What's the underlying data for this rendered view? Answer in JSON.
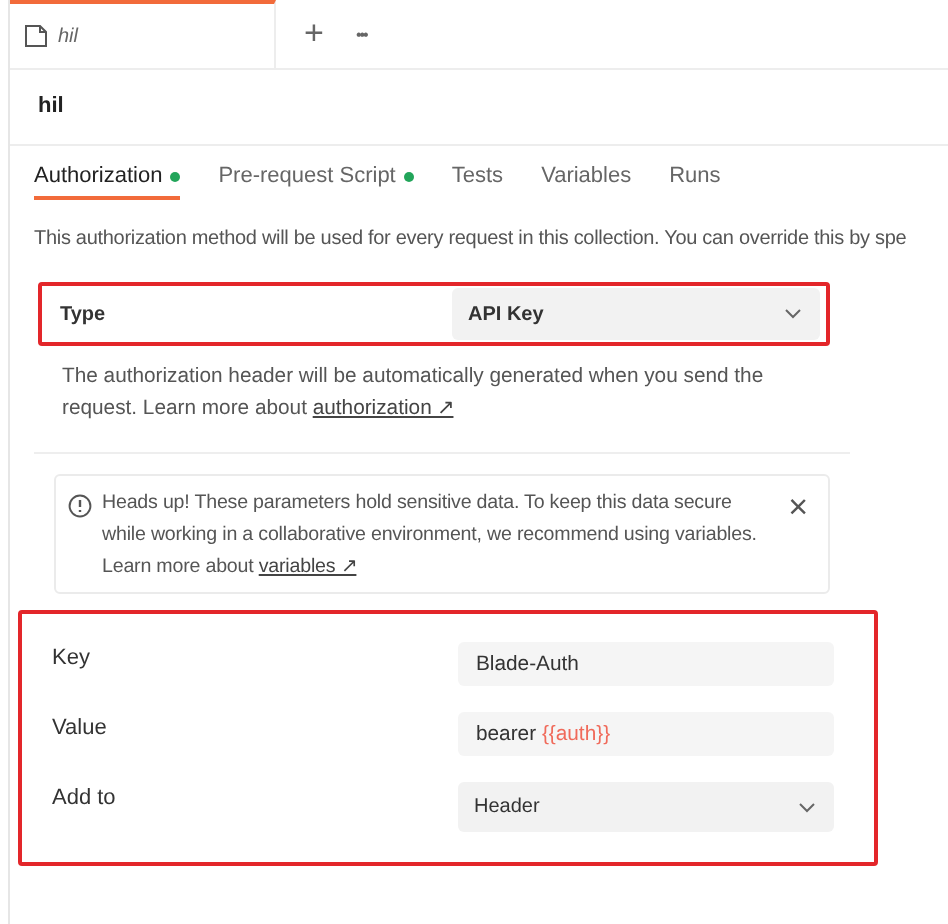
{
  "open_tab": {
    "title": "hil",
    "selected": true
  },
  "tab_actions": [
    "+",
    "•••"
  ],
  "collection_name": "hil",
  "tabs": [
    {
      "label": "Authorization",
      "selected": true,
      "has_dot": true
    },
    {
      "label": "Pre-request Script",
      "selected": false,
      "has_dot": true
    },
    {
      "label": "Tests",
      "selected": false,
      "has_dot": false
    },
    {
      "label": "Variables",
      "selected": false,
      "has_dot": false
    },
    {
      "label": "Runs",
      "selected": false,
      "has_dot": false
    }
  ],
  "description": "This authorization method will be used for every request in this collection. You can override this by spe",
  "type_section": {
    "label": "Type",
    "value": "API Key",
    "highlighted": true
  },
  "help_text": "The authorization header will be automatically generated when you send the request. Learn more about",
  "help_link": "authorization ↗",
  "alert": {
    "text": "Heads up! These parameters hold sensitive data. To keep this data secure while working in a collaborative environment, we recommend using variables. Learn more about",
    "link": "variables ↗",
    "close": "×"
  },
  "params": {
    "highlighted": true,
    "fields": [
      {
        "label": "Key",
        "kind": "input",
        "value": "Blade-Auth"
      },
      {
        "label": "Value",
        "kind": "input",
        "value": "bearer ",
        "variable": "{{auth}}"
      },
      {
        "label": "Add to",
        "kind": "select",
        "value": "Header"
      }
    ]
  }
}
